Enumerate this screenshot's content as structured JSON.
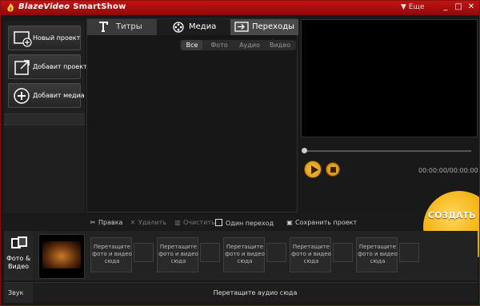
{
  "app": {
    "brand_part1": "BlazeVideo",
    "brand_part2": "SmartShow",
    "more_label": "▼ Еще"
  },
  "sidebar": {
    "items": [
      {
        "label": "Новый проект",
        "icon": "new-project-icon"
      },
      {
        "label": "Добавит проект",
        "icon": "open-project-icon"
      },
      {
        "label": "Добавит медиа",
        "icon": "add-media-icon"
      }
    ]
  },
  "tabs": [
    {
      "label": "Титры",
      "icon": "text-icon"
    },
    {
      "label": "Медиа",
      "icon": "film-reel-icon"
    },
    {
      "label": "Переходы",
      "icon": "transition-icon"
    }
  ],
  "filters": [
    "Все",
    "Фото",
    "Аудио",
    "Видео"
  ],
  "player": {
    "time": "00:00:00/00:00:00"
  },
  "create_label": "СОЗДАТЬ",
  "toolbar": {
    "edit": "Правка",
    "delete": "Удалить",
    "clear": "Очистить",
    "one_transition": "Один переход",
    "save_project": "Сохранить проект"
  },
  "timeline": {
    "track_label": "Фото & Видео",
    "slot_text": "Перетащите фото и видео сюда"
  },
  "audio": {
    "label": "Звук",
    "placeholder": "Перетащите аудио сюда"
  },
  "colors": {
    "title_bar": "#b01010",
    "accent_gold": "#f0a800",
    "panel": "#191919"
  }
}
